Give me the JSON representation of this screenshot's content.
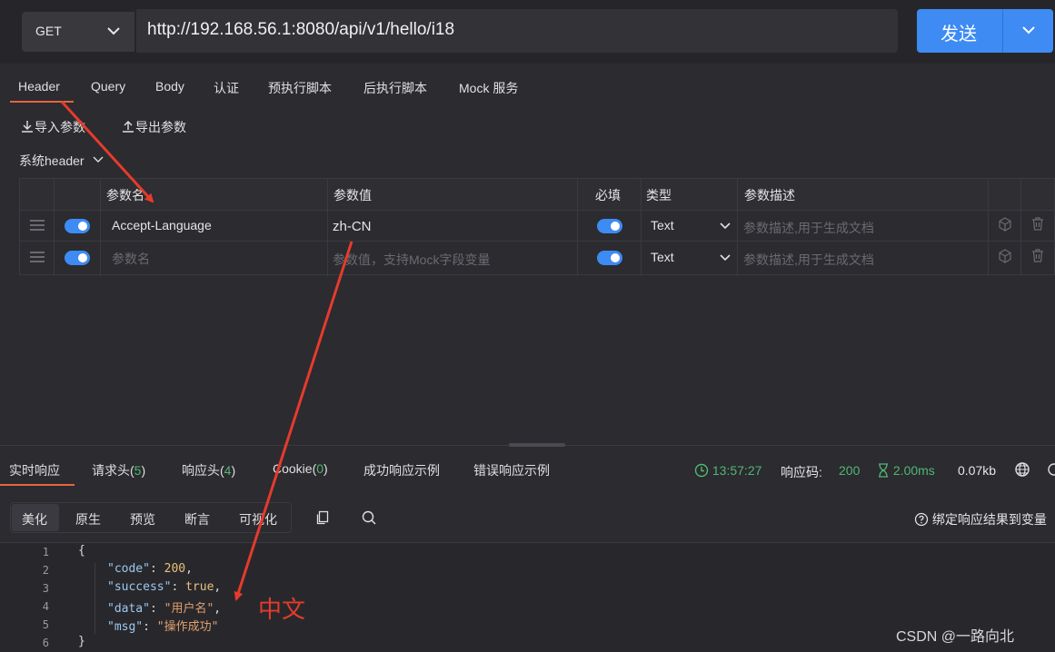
{
  "request": {
    "method": "GET",
    "url": "http://192.168.56.1:8080/api/v1/hello/i18",
    "send_label": "发送"
  },
  "tabs": [
    "Header",
    "Query",
    "Body",
    "认证",
    "预执行脚本",
    "后执行脚本",
    "Mock 服务"
  ],
  "active_tab": "Header",
  "tools": {
    "import": "导入参数",
    "export": "导出参数"
  },
  "system_header": "系统header",
  "table": {
    "headers": {
      "name": "参数名",
      "value": "参数值",
      "required": "必填",
      "type": "类型",
      "desc": "参数描述"
    },
    "rows": [
      {
        "name": "Accept-Language",
        "value": "zh-CN",
        "type": "Text",
        "desc_placeholder": "参数描述,用于生成文档",
        "enabled": true,
        "required": true
      },
      {
        "name_placeholder": "参数名",
        "value_placeholder": "参数值，支持Mock字段变量",
        "type": "Text",
        "desc_placeholder": "参数描述,用于生成文档",
        "enabled": true,
        "required": true
      }
    ]
  },
  "response_tabs": {
    "realtime": "实时响应",
    "req_headers": "请求头(",
    "req_headers_count": "5",
    "resp_headers": "响应头(",
    "resp_headers_count": "4",
    "cookie": "Cookie(",
    "cookie_count": "0",
    "close_paren": ")",
    "success_example": "成功响应示例",
    "error_example": "错误响应示例"
  },
  "status": {
    "time": "13:57:27",
    "code_label": "响应码:",
    "code": "200",
    "duration": "2.00ms",
    "size": "0.07kb",
    "bind_label": "绑定响应结果到变量"
  },
  "view_buttons": [
    "美化",
    "原生",
    "预览",
    "断言",
    "可视化"
  ],
  "code_lines": {
    "l1": "{",
    "k2": "\"code\"",
    "v2": "200",
    "k3": "\"success\"",
    "v3": "true",
    "k4": "\"data\"",
    "v4": "\"用户名\"",
    "k5": "\"msg\"",
    "v5": "\"操作成功\"",
    "l6": "}"
  },
  "line_numbers": [
    "1",
    "2",
    "3",
    "4",
    "5",
    "6"
  ],
  "annotation": "中文",
  "watermark": "CSDN @一路向北",
  "colors": {
    "accent": "#3d8bf3",
    "tab_underline": "#e8643c",
    "arrow": "#e53b2c",
    "success": "#4fb872"
  }
}
